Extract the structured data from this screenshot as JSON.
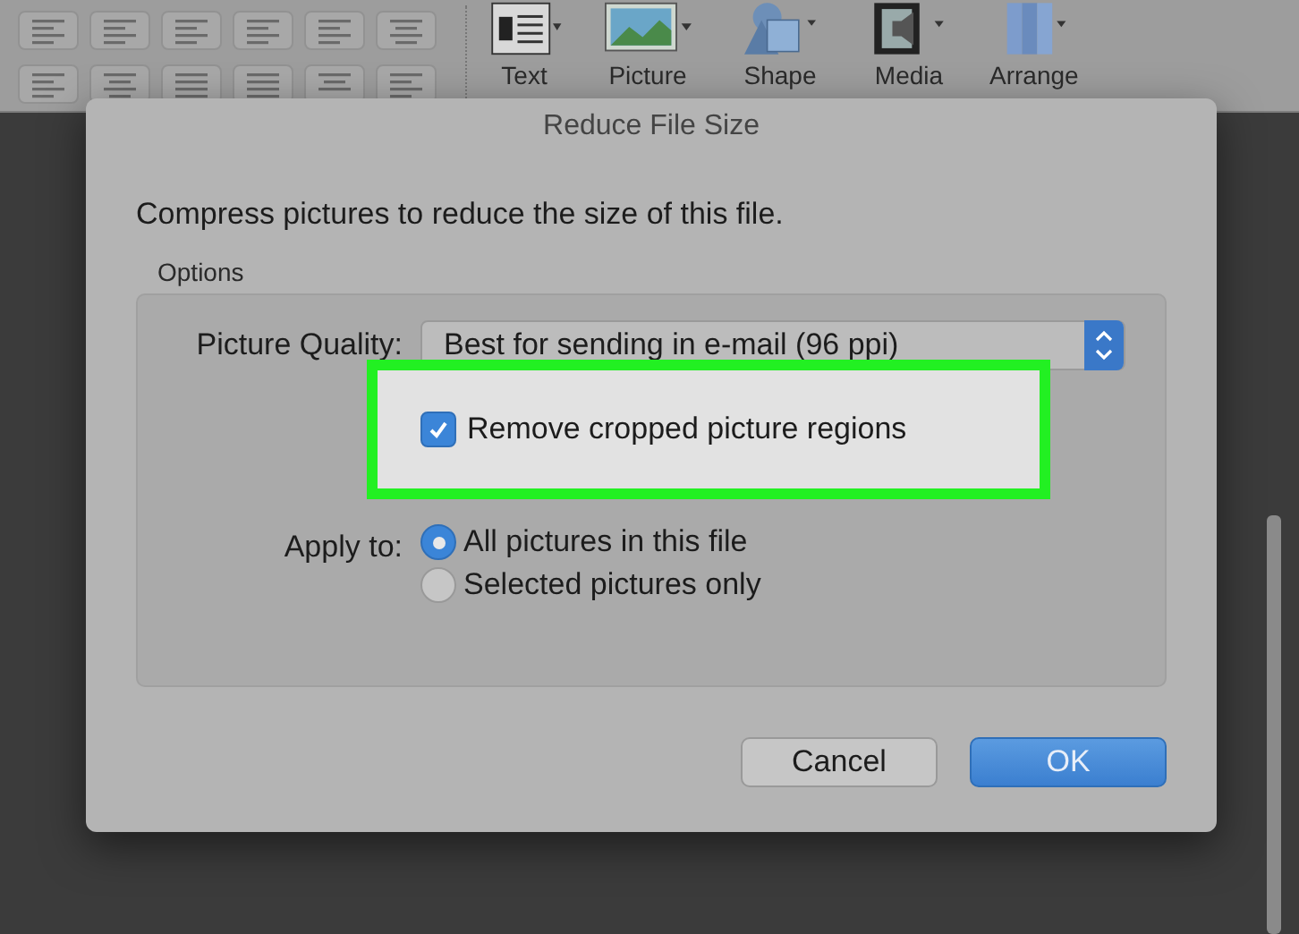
{
  "toolbar": {
    "items": [
      {
        "kind": "text",
        "label": "Text"
      },
      {
        "kind": "picture",
        "label": "Picture"
      },
      {
        "kind": "shape",
        "label": "Shape"
      },
      {
        "kind": "media",
        "label": "Media"
      },
      {
        "kind": "arrange",
        "label": "Arrange"
      }
    ]
  },
  "dialog": {
    "title": "Reduce File Size",
    "description": "Compress pictures to reduce the size of this file.",
    "group_label": "Options",
    "picture_quality": {
      "label": "Picture Quality:",
      "value": "Best for sending in e-mail (96 ppi)"
    },
    "remove_cropped": {
      "label": "Remove cropped picture regions",
      "checked": true,
      "highlighted": true
    },
    "apply_to": {
      "label": "Apply to:",
      "options": [
        {
          "label": "All pictures in this file",
          "selected": true
        },
        {
          "label": "Selected pictures only",
          "selected": false
        }
      ]
    },
    "buttons": [
      {
        "label": "Cancel",
        "kind": "secondary"
      },
      {
        "label": "OK",
        "kind": "default"
      }
    ]
  }
}
